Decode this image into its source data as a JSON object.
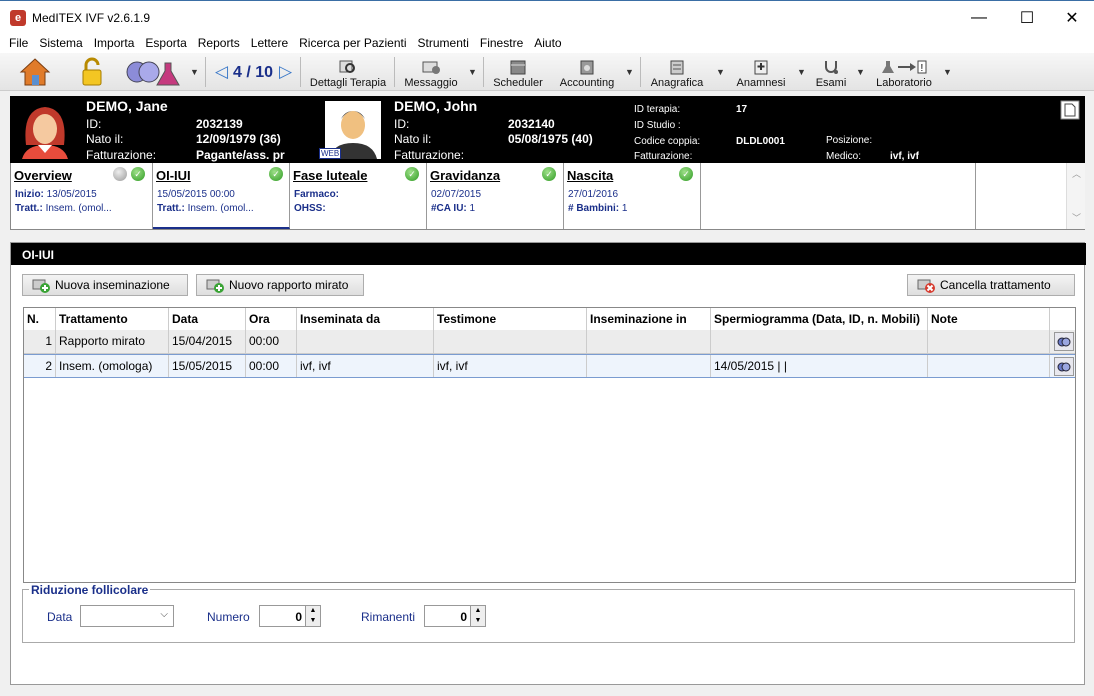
{
  "window": {
    "title": "MedITEX IVF v2.6.1.9",
    "minimize": "—",
    "maximize": "☐",
    "close": "✕"
  },
  "menu": [
    "File",
    "Sistema",
    "Importa",
    "Esporta",
    "Reports",
    "Lettere",
    "Ricerca per Pazienti",
    "Strumenti",
    "Finestre",
    "Aiuto"
  ],
  "toolbar": {
    "pager": "4 / 10",
    "dettagli_terapia": "Dettagli Terapia",
    "messaggio": "Messaggio",
    "scheduler": "Scheduler",
    "accounting": "Accounting",
    "anagrafica": "Anagrafica",
    "anamnesi": "Anamnesi",
    "esami": "Esami",
    "laboratorio": "Laboratorio"
  },
  "patient_female": {
    "name": "DEMO, Jane",
    "id_label": "ID:",
    "id": "2032139",
    "dob_label": "Nato il:",
    "dob": "12/09/1979  (36)",
    "billing_label": "Fatturazione:",
    "billing": "Pagante/ass. pr"
  },
  "patient_male": {
    "name": "DEMO, John",
    "id_label": "ID:",
    "id": "2032140",
    "dob_label": "Nato il:",
    "dob": "05/08/1975  (40)",
    "billing_label": "Fatturazione:",
    "web_badge": "WEB"
  },
  "therapy": {
    "id_label": "ID terapia:",
    "id": "17",
    "studio_label": "ID Studio :",
    "couple_label": "Codice coppia:",
    "couple": "DLDL0001",
    "billing_label": "Fatturazione:",
    "position_label": "Posizione:",
    "doctor_label": "Medico:",
    "doctor": "ivf, ivf"
  },
  "tabs": [
    {
      "title": "Overview",
      "l1": "Inizio:",
      "v1": "13/05/2015",
      "l2": "Tratt.:",
      "v2": "Insem. (omol..."
    },
    {
      "title": "OI-IUI",
      "l1": "",
      "v1": "15/05/2015 00:00",
      "l2": "Tratt.:",
      "v2": "Insem. (omol..."
    },
    {
      "title": "Fase luteale",
      "l1": "Farmaco:",
      "v1": "",
      "l2": "OHSS:",
      "v2": ""
    },
    {
      "title": "Gravidanza",
      "l1": "",
      "v1": "02/07/2015",
      "l2": "#CA IU:",
      "v2": "1"
    },
    {
      "title": "Nascita",
      "l1": "",
      "v1": "27/01/2016",
      "l2": "# Bambini:",
      "v2": "1"
    }
  ],
  "panel": {
    "title": "OI-IUI",
    "new_insemination": "Nuova inseminazione",
    "new_report": "Nuovo rapporto mirato",
    "cancel_treatment": "Cancella trattamento"
  },
  "grid": {
    "headers": [
      "N.",
      "Trattamento",
      "Data",
      "Ora",
      "Inseminata da",
      "Testimone",
      "Inseminazione in",
      "Spermiogramma (Data, ID, n. Mobili)",
      "Note"
    ],
    "rows": [
      [
        "1",
        "Rapporto mirato",
        "15/04/2015",
        "00:00",
        "",
        "",
        "",
        "",
        ""
      ],
      [
        "2",
        "Insem. (omologa)",
        "15/05/2015",
        "00:00",
        "ivf, ivf",
        "ivf, ivf",
        "",
        "14/05/2015 |  |",
        ""
      ]
    ]
  },
  "reduction": {
    "legend": "Riduzione follicolare",
    "data_label": "Data",
    "numero_label": "Numero",
    "numero": "0",
    "rimanenti_label": "Rimanenti",
    "rimanenti": "0"
  }
}
